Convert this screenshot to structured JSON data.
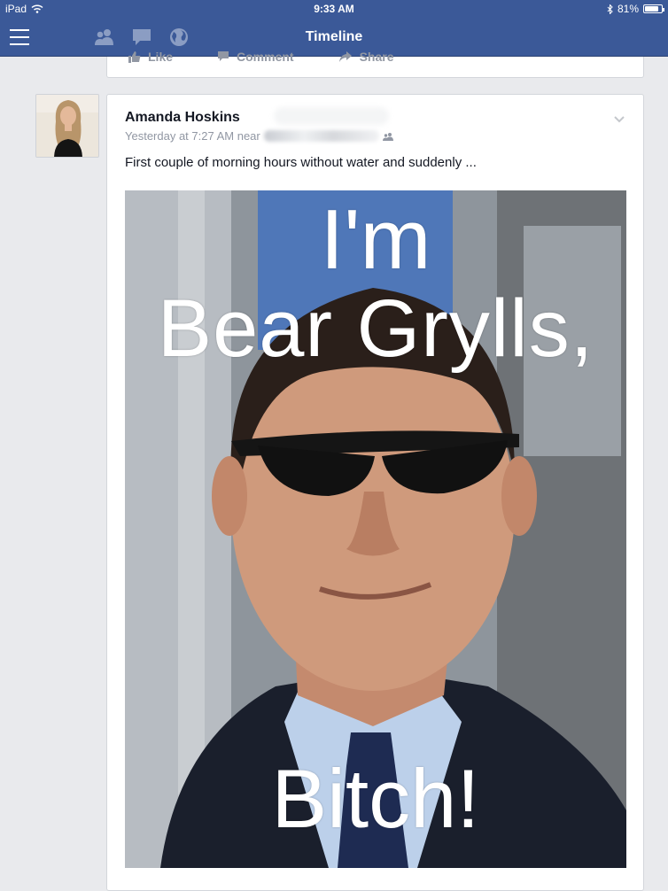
{
  "statusbar": {
    "device": "iPad",
    "time": "9:33 AM",
    "battery_percent": "81%",
    "battery_level": 0.81
  },
  "navbar": {
    "title": "Timeline",
    "icons": [
      "menu-icon",
      "friends-icon",
      "messages-icon",
      "notifications-globe-icon"
    ]
  },
  "previous_story": {
    "actions": [
      {
        "label": "Like",
        "icon": "thumbs-up-icon"
      },
      {
        "label": "Comment",
        "icon": "comment-icon"
      },
      {
        "label": "Share",
        "icon": "share-arrow-icon"
      }
    ]
  },
  "post": {
    "author": "Amanda Hoskins",
    "timestamp": "Yesterday at 7:27 AM near",
    "text": "First couple of morning hours without water and suddenly ...",
    "photo": {
      "line1": "I'm",
      "line2": "Bear Grylls,",
      "line3": "Bitch!"
    }
  },
  "colors": {
    "brand": "#3b5998",
    "background": "#e9eaed",
    "meta_text": "#9197a3",
    "body_text": "#141823"
  }
}
